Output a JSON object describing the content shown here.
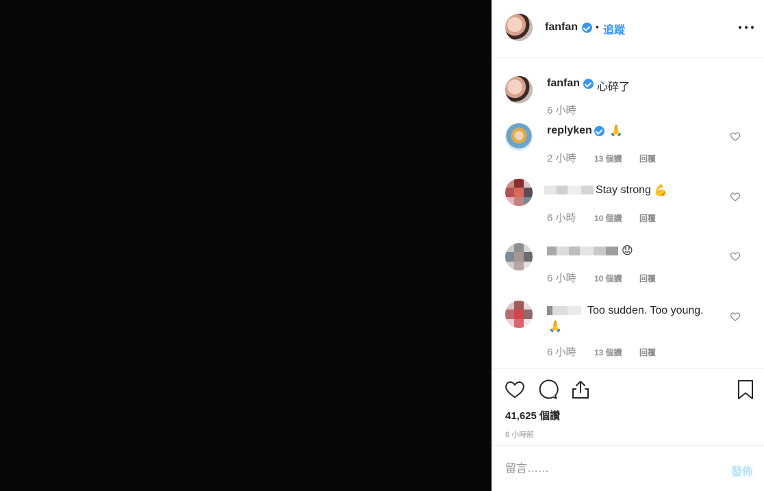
{
  "post": {
    "owner": {
      "username": "fanfan",
      "verified": true
    },
    "separator": "•",
    "follow_label": "追蹤",
    "more_icon": "more-horizontal-icon",
    "caption": {
      "username": "fanfan",
      "text": "心碎了",
      "time": "6 小時"
    },
    "comments": [
      {
        "username": "replyken",
        "emoji": "🙏",
        "time": "2 小時",
        "likes": "13 個讚",
        "reply": "回覆"
      },
      {
        "text": "Stay strong",
        "emoji": "💪",
        "time": "6 小時",
        "likes": "10 個讚",
        "reply": "回覆"
      },
      {
        "emoji": "😟",
        "time": "6 小時",
        "likes": "10 個讚",
        "reply": "回覆"
      },
      {
        "text": "Too sudden. Too young.",
        "emoji": "🙏",
        "time": "6 小時",
        "likes": "13 個讚",
        "reply": "回覆"
      }
    ],
    "actions": {
      "likes": "41,625 個讚",
      "time_ago": "6 小時前"
    },
    "composer": {
      "placeholder": "留言……",
      "post_label": "發佈"
    },
    "colors": {
      "accent": "#3897f0",
      "muted": "#8e8e8e",
      "post_disabled": "#b2dffc",
      "media_bg": "#050708"
    }
  }
}
